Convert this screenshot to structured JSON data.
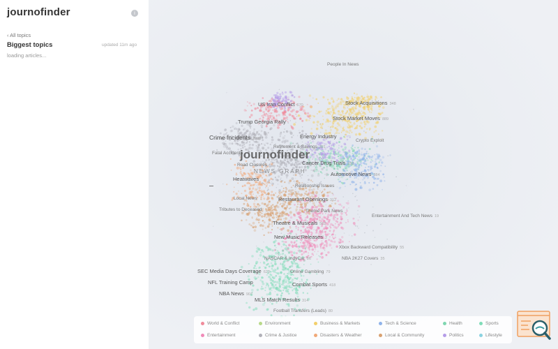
{
  "app": {
    "brand": "journofinder"
  },
  "sidebar": {
    "back_label": "‹ All topics",
    "title": "Biggest topics",
    "updated": "updated 11m ago",
    "loading": "loading articles..."
  },
  "map": {
    "title": "journofinder",
    "subtitle": "NEWS GRAPH",
    "labels": [
      {
        "text": "People In News",
        "count": "",
        "size": "small"
      },
      {
        "text": "US Iran Conflict",
        "count": "670",
        "size": "normal"
      },
      {
        "text": "Stock Acquisitions",
        "count": "348",
        "size": "normal"
      },
      {
        "text": "Trump Georgia Rally",
        "count": "",
        "size": "normal"
      },
      {
        "text": "Stock Market Moves",
        "count": "889",
        "size": "normal"
      },
      {
        "text": "Crime Incidents",
        "count": "2930",
        "size": "big"
      },
      {
        "text": "Energy Industry",
        "count": "",
        "size": "normal"
      },
      {
        "text": "Crypto Exploit",
        "count": "",
        "size": "small"
      },
      {
        "text": "Retirement & Savings",
        "count": "321",
        "size": "small"
      },
      {
        "text": "Fatal Accidents",
        "count": "",
        "size": "small"
      },
      {
        "text": "Road Closures",
        "count": "",
        "size": "small"
      },
      {
        "text": "Cancer Drug Trials",
        "count": "253",
        "size": "normal"
      },
      {
        "text": "Automotive News",
        "count": "384",
        "size": "normal"
      },
      {
        "text": "Heatwaves",
        "count": "",
        "size": "normal"
      },
      {
        "text": "Relationship Issues",
        "count": "",
        "size": "small"
      },
      {
        "text": "Local News",
        "count": "",
        "size": "small"
      },
      {
        "text": "Restaurant Openings",
        "count": "312",
        "size": "normal"
      },
      {
        "text": "Tributes to Deceased",
        "count": "",
        "size": "small"
      },
      {
        "text": "Theme Park News",
        "count": "",
        "size": "small"
      },
      {
        "text": "Entertainment And Tech News",
        "count": "19",
        "size": "small"
      },
      {
        "text": "Theatre & Musicals",
        "count": "562",
        "size": "normal"
      },
      {
        "text": "New Music Releases",
        "count": "2",
        "size": "normal"
      },
      {
        "text": "Xbox Backward Compatibility",
        "count": "55",
        "size": "small"
      },
      {
        "text": "NASCAR & IndyCar",
        "count": "86",
        "size": "small"
      },
      {
        "text": "NBA 2K27 Covers",
        "count": "35",
        "size": "small"
      },
      {
        "text": "SEC Media Days Coverage",
        "count": "623",
        "size": "normal"
      },
      {
        "text": "Online Gambling",
        "count": "79",
        "size": "small"
      },
      {
        "text": "NFL Training Camp",
        "count": "",
        "size": "normal"
      },
      {
        "text": "Combat Sports",
        "count": "418",
        "size": "normal"
      },
      {
        "text": "NBA News",
        "count": "907",
        "size": "normal"
      },
      {
        "text": "MLS Match Results",
        "count": "314",
        "size": "normal"
      },
      {
        "text": "Football Transfers (Leads)",
        "count": "80",
        "size": "small"
      }
    ]
  },
  "legend": {
    "items": [
      {
        "label": "World & Conflict",
        "color": "#f08a9a"
      },
      {
        "label": "Environment",
        "color": "#b8d98a"
      },
      {
        "label": "Business & Markets",
        "color": "#f2cf6a"
      },
      {
        "label": "Tech & Science",
        "color": "#8fb3ea"
      },
      {
        "label": "Health",
        "color": "#7fd6b0"
      },
      {
        "label": "Sports",
        "color": "#7fdcb8"
      },
      {
        "label": "Entertainment",
        "color": "#f08ab8"
      },
      {
        "label": "Crime & Justice",
        "color": "#b0b0b8"
      },
      {
        "label": "Disasters & Weather",
        "color": "#f0a878"
      },
      {
        "label": "Local & Community",
        "color": "#d8a070"
      },
      {
        "label": "Politics",
        "color": "#b59ce8"
      },
      {
        "label": "Lifestyle",
        "color": "#8ad2e0"
      }
    ]
  },
  "icons": {
    "info": "info-icon",
    "logo": "journofinder-logo-icon"
  }
}
